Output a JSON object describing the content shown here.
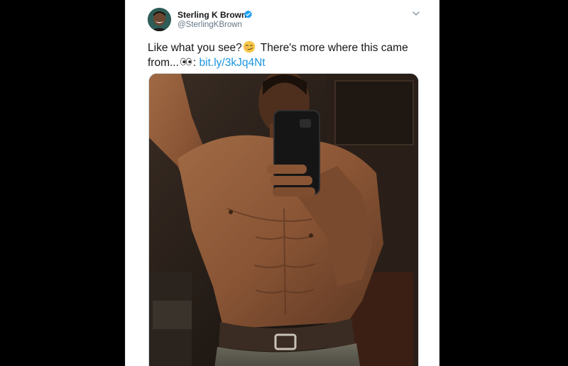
{
  "tweet": {
    "display_name": "Sterling K Brown",
    "handle": "@SterlingKBrown",
    "text_part1": "Like what you see?",
    "text_part2": " There's more where this came",
    "text_part3": "from...",
    "text_part4": ":",
    "link_text": "bit.ly/3kJq4Nt",
    "icons": {
      "verified": "verified-badge-icon",
      "menu": "chevron-down-icon",
      "emoji1": "smirking-face-emoji",
      "emoji2": "eyes-emoji"
    },
    "colors": {
      "link": "#1b95e0",
      "verified": "#1da1f2",
      "name": "#14171a",
      "handle": "#657786"
    }
  },
  "media": {
    "type": "photo",
    "description_icon": "mirror-selfie-photo"
  }
}
